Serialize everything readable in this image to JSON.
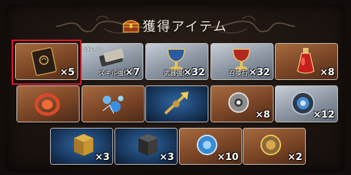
{
  "header": {
    "title": "獲得アイテム"
  },
  "items": [
    {
      "quantity": "×5",
      "icon": "spellbook-icon"
    },
    {
      "tag": "SSレア",
      "name": "スキル強化",
      "quantity": "×7",
      "icon": "skill-scroll-icon"
    },
    {
      "name": "武器強化",
      "quantity": "×32",
      "icon": "blue-chalice-icon"
    },
    {
      "name": "召喚石",
      "quantity": "×32",
      "icon": "red-chalice-icon"
    },
    {
      "quantity": "×8",
      "icon": "red-potion-icon"
    },
    {
      "quantity": "",
      "icon": "red-gem-ring-icon"
    },
    {
      "quantity": "",
      "icon": "blue-crystal-icon"
    },
    {
      "quantity": "",
      "icon": "golden-weapon-icon"
    },
    {
      "quantity": "×8",
      "icon": "silver-orb-icon"
    },
    {
      "quantity": "×12",
      "icon": "blue-medallion-icon"
    },
    {
      "quantity": "×3",
      "icon": "gold-cube-icon"
    },
    {
      "quantity": "×3",
      "icon": "dark-cube-icon"
    },
    {
      "quantity": "×10",
      "icon": "blue-rune-orb-icon"
    },
    {
      "quantity": "×2",
      "icon": "golden-rune-orb-icon"
    }
  ],
  "colors": {
    "selection": "#e0192a",
    "panel": "#1c1410"
  }
}
